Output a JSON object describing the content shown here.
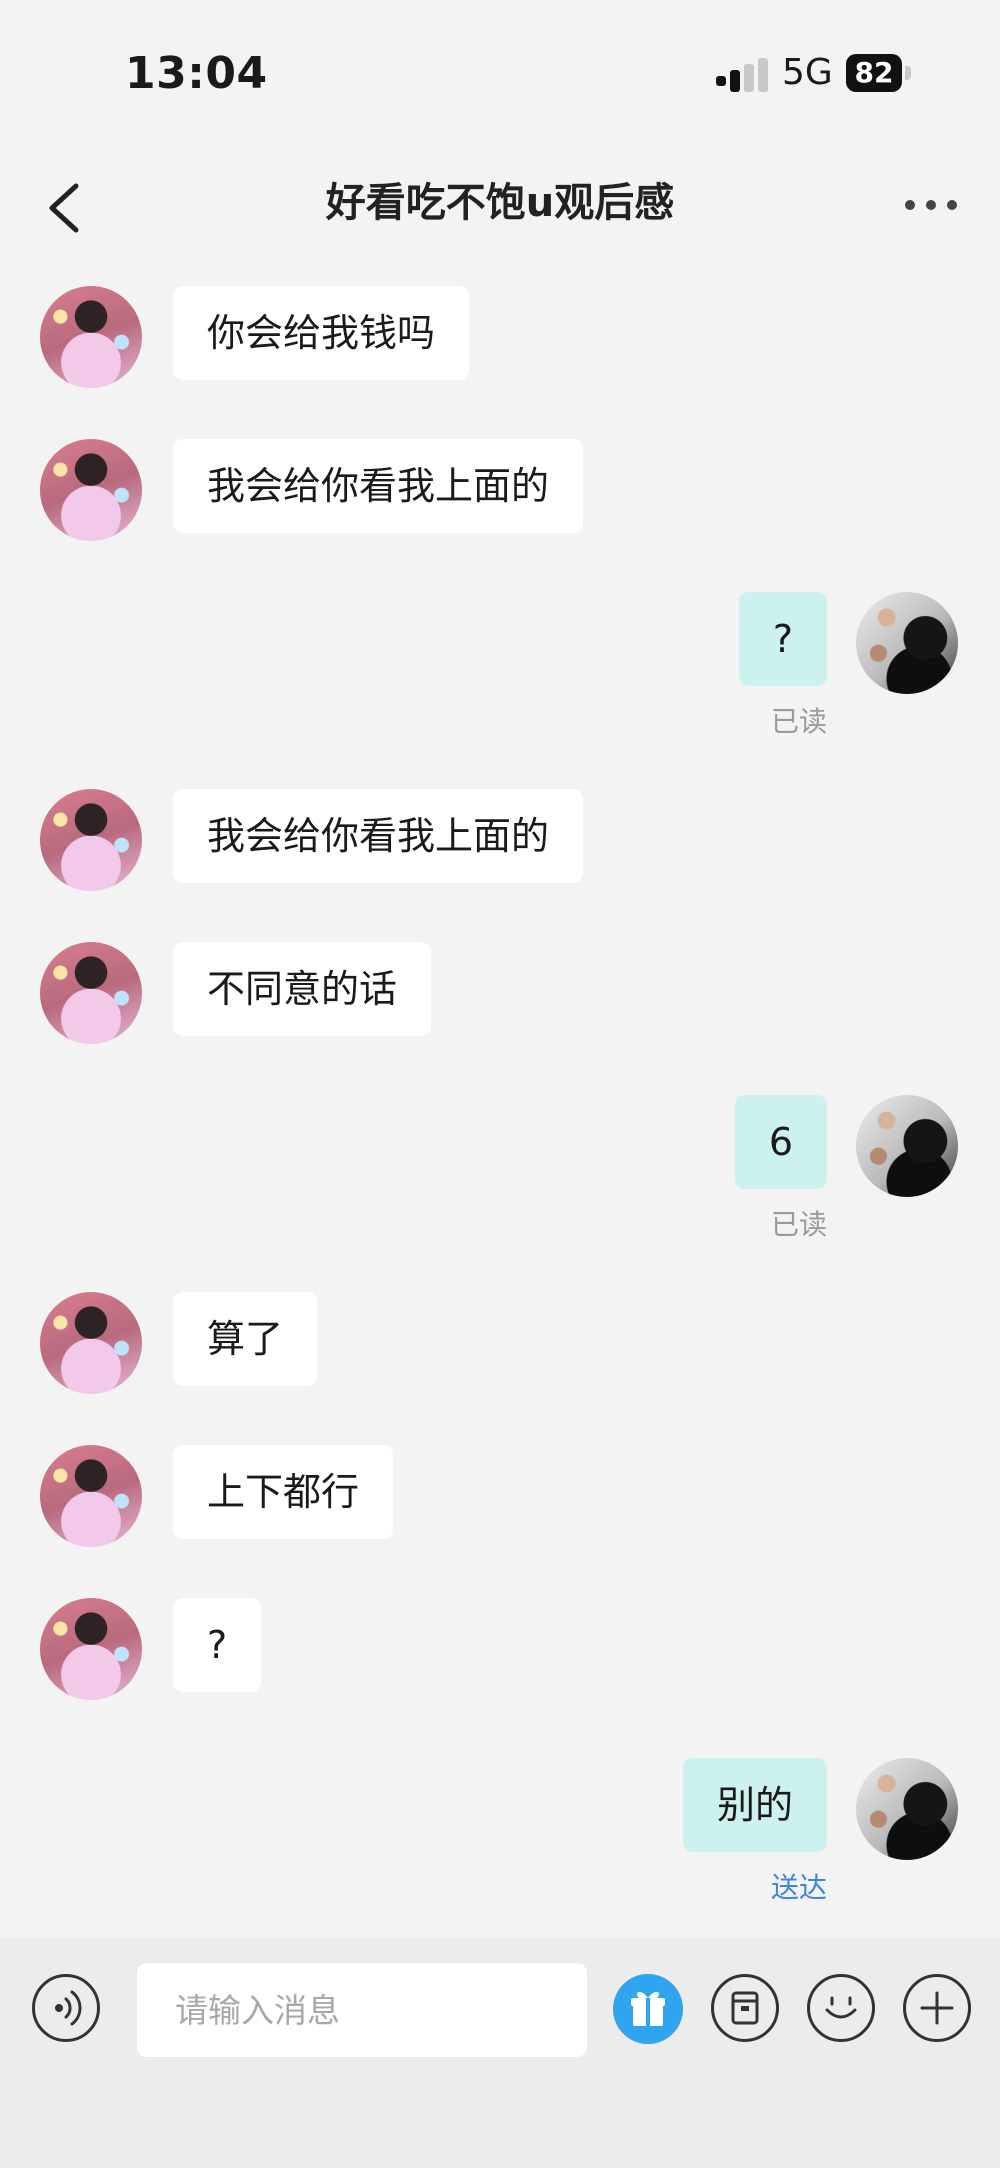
{
  "status_bar": {
    "time": "13:04",
    "network": "5G",
    "battery_level": "82",
    "icons": [
      "cellular-signal-icon",
      "battery-icon"
    ]
  },
  "header": {
    "title": "好看吃不饱u观后感",
    "icons": [
      "back-chevron-icon",
      "more-dots-icon"
    ]
  },
  "messages": [
    {
      "sender": "them",
      "text": "你会给我钱吗"
    },
    {
      "sender": "them",
      "text": "我会给你看我上面的"
    },
    {
      "sender": "me",
      "text": "?",
      "receipt": "已读"
    },
    {
      "sender": "them",
      "text": "我会给你看我上面的"
    },
    {
      "sender": "them",
      "text": "不同意的话"
    },
    {
      "sender": "me",
      "text": "6",
      "receipt": "已读"
    },
    {
      "sender": "them",
      "text": "算了"
    },
    {
      "sender": "them",
      "text": "上下都行"
    },
    {
      "sender": "them",
      "text": "?"
    },
    {
      "sender": "me",
      "text": "别的",
      "receipt": "送达"
    }
  ],
  "input_bar": {
    "placeholder": "请输入消息",
    "value": "",
    "icons": [
      "voice-icon",
      "gift-icon",
      "sticker-icon",
      "emoji-icon",
      "plus-icon"
    ]
  },
  "colors": {
    "background": "#f3f3f3",
    "incoming_bubble": "#ffffff",
    "outgoing_bubble": "#cdf1ee",
    "read_receipt": "#9a9a9a",
    "delivered_receipt": "#3f84e0",
    "gift_button": "#2fa5f0"
  }
}
